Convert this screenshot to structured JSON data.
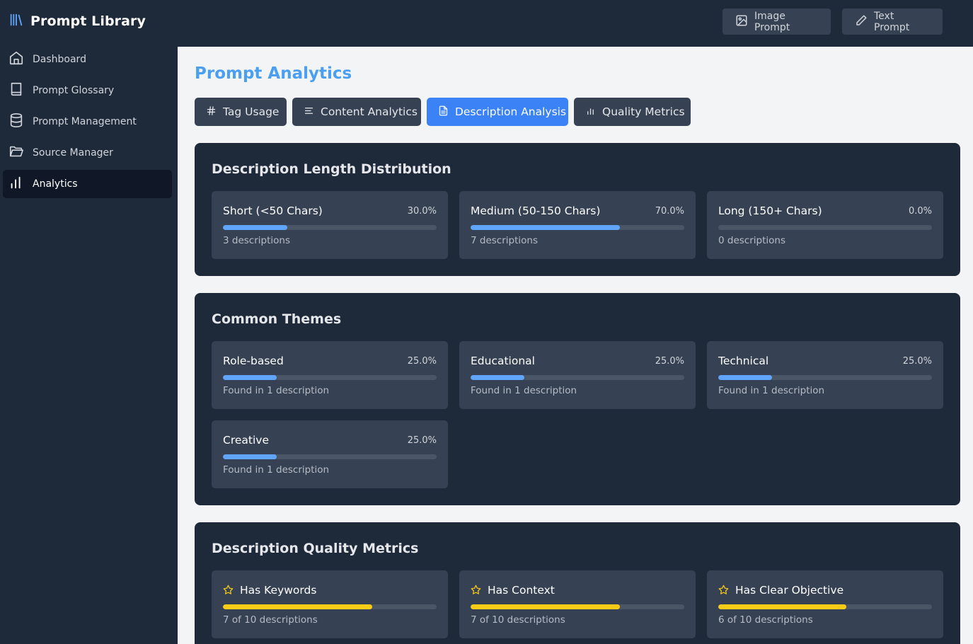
{
  "app": {
    "title": "Prompt Library"
  },
  "header": {
    "image_prompt_label": "Image Prompt",
    "text_prompt_label": "Text Prompt"
  },
  "sidebar": {
    "items": [
      {
        "label": "Dashboard",
        "icon": "home-icon"
      },
      {
        "label": "Prompt Glossary",
        "icon": "book-icon"
      },
      {
        "label": "Prompt Management",
        "icon": "database-icon"
      },
      {
        "label": "Source Manager",
        "icon": "folder-icon"
      },
      {
        "label": "Analytics",
        "icon": "bar-chart-icon",
        "active": true
      }
    ]
  },
  "main": {
    "title": "Prompt Analytics",
    "tabs": [
      {
        "label": "Tag Usage",
        "icon": "hash-icon"
      },
      {
        "label": "Content Analytics",
        "icon": "align-left-icon"
      },
      {
        "label": "Description Analysis",
        "icon": "file-text-icon",
        "active": true
      },
      {
        "label": "Quality Metrics",
        "icon": "bar-chart-icon"
      }
    ]
  },
  "length_distribution": {
    "title": "Description Length Distribution",
    "items": [
      {
        "label": "Short (<50 Chars)",
        "percent": "30.0%",
        "fraction": 0.3,
        "sub": "3 descriptions"
      },
      {
        "label": "Medium (50-150 Chars)",
        "percent": "70.0%",
        "fraction": 0.7,
        "sub": "7 descriptions"
      },
      {
        "label": "Long (150+ Chars)",
        "percent": "0.0%",
        "fraction": 0.0,
        "sub": "0 descriptions"
      }
    ]
  },
  "themes": {
    "title": "Common Themes",
    "items": [
      {
        "label": "Role-based",
        "percent": "25.0%",
        "fraction": 0.25,
        "sub": "Found in 1 description"
      },
      {
        "label": "Educational",
        "percent": "25.0%",
        "fraction": 0.25,
        "sub": "Found in 1 description"
      },
      {
        "label": "Technical",
        "percent": "25.0%",
        "fraction": 0.25,
        "sub": "Found in 1 description"
      },
      {
        "label": "Creative",
        "percent": "25.0%",
        "fraction": 0.25,
        "sub": "Found in 1 description"
      }
    ]
  },
  "quality": {
    "title": "Description Quality Metrics",
    "items": [
      {
        "label": "Has Keywords",
        "fraction": 0.7,
        "sub": "7 of 10 descriptions"
      },
      {
        "label": "Has Context",
        "fraction": 0.7,
        "sub": "7 of 10 descriptions"
      },
      {
        "label": "Has Clear Objective",
        "fraction": 0.6,
        "sub": "6 of 10 descriptions"
      }
    ]
  },
  "colors": {
    "accent": "#3b82f6",
    "title_blue": "#4b9ff0",
    "bar_blue": "#60a5fa",
    "bar_yellow": "#facc15",
    "panel": "#1e2939",
    "card": "#364153"
  }
}
